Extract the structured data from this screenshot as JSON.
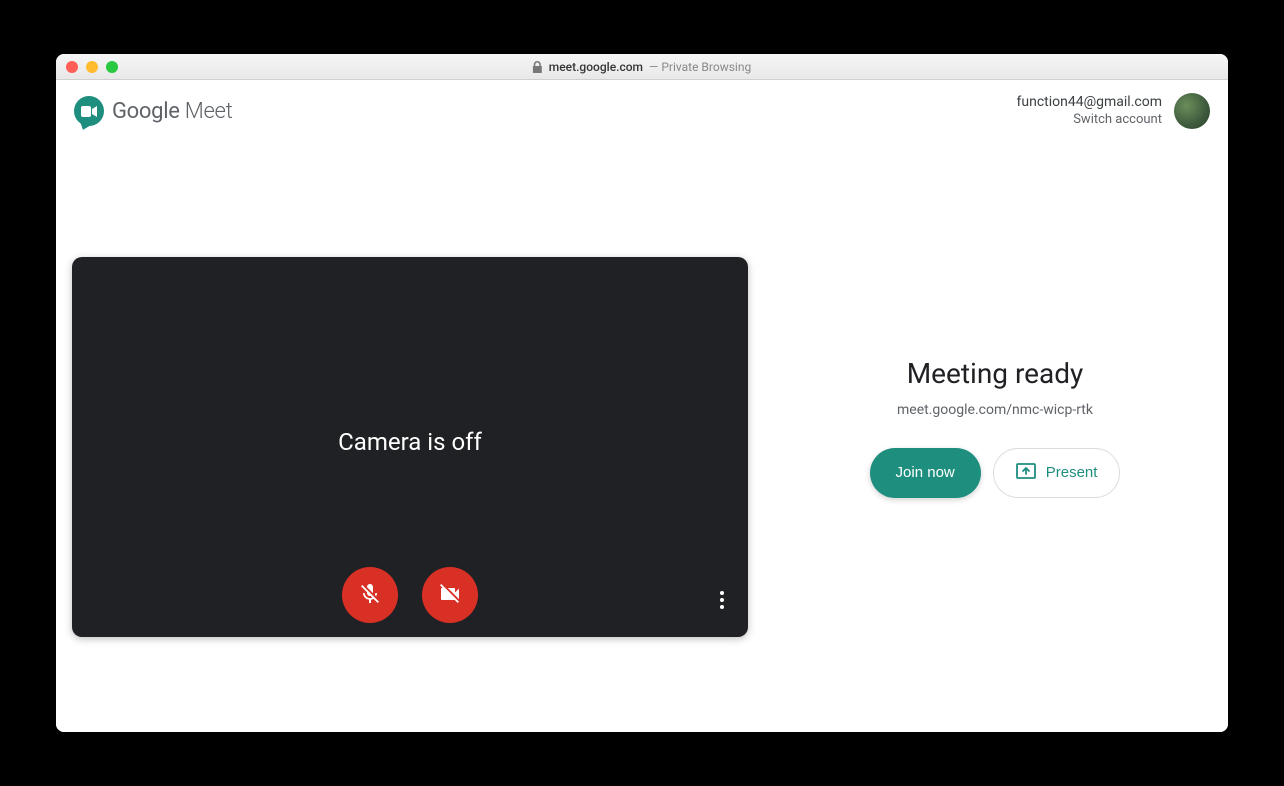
{
  "browser": {
    "domain": "meet.google.com",
    "suffix": " — Private Browsing"
  },
  "header": {
    "logo_text_google": "Google",
    "logo_text_meet": " Meet",
    "account_email": "function44@gmail.com",
    "switch_account_label": "Switch account"
  },
  "video": {
    "camera_status": "Camera is off"
  },
  "join": {
    "title": "Meeting ready",
    "meeting_url": "meet.google.com/nmc-wicp-rtk",
    "join_label": "Join now",
    "present_label": "Present"
  },
  "colors": {
    "accent": "#1e8e7e",
    "danger": "#d93025"
  }
}
